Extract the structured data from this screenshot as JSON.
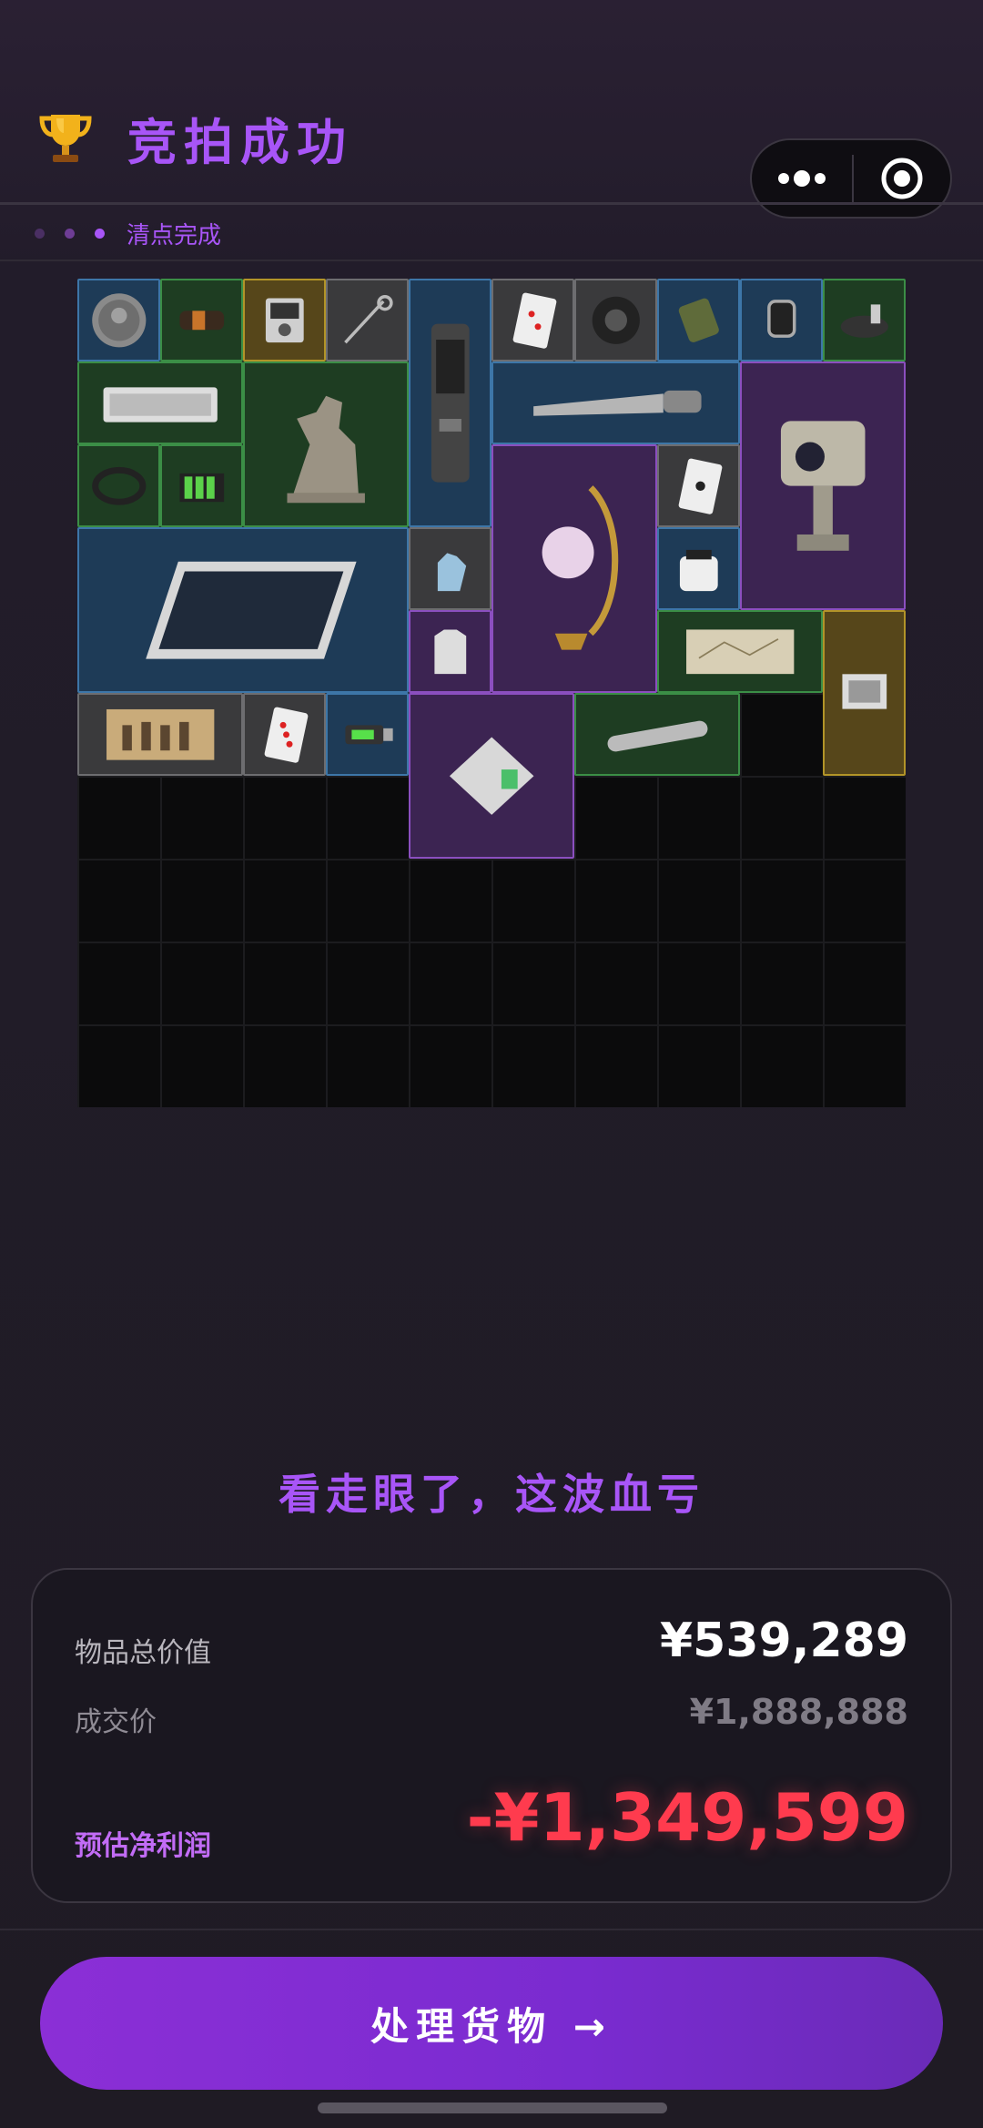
{
  "header": {
    "title": "竞拍成功",
    "trophy_icon": "trophy-icon",
    "status_text": "清点完成",
    "status_dots": [
      "#4a2f63",
      "#6e3d95",
      "#a855f7"
    ],
    "accent": "#a855f7"
  },
  "capsule": {
    "more_icon": "more-dots-icon",
    "close_icon": "target-icon"
  },
  "inventory": {
    "rarity_colors": {
      "blue": "#3d76a8",
      "green": "#3b8e46",
      "purple": "#8b4fbf",
      "gold": "#b29428",
      "gray": "#6d6d70"
    },
    "items": [
      {
        "name": "coin",
        "icon": "coin-icon",
        "rarity": "blue"
      },
      {
        "name": "cable-bundle",
        "icon": "cable-icon",
        "rarity": "green"
      },
      {
        "name": "multimeter",
        "icon": "multimeter-icon",
        "rarity": "gold"
      },
      {
        "name": "scissors",
        "icon": "scissors-icon",
        "rarity": "gray"
      },
      {
        "name": "rangefinder",
        "icon": "device-icon",
        "rarity": "blue"
      },
      {
        "name": "playing-card",
        "icon": "card-icon",
        "rarity": "gray"
      },
      {
        "name": "tape",
        "icon": "tape-icon",
        "rarity": "gray"
      },
      {
        "name": "ration-pack",
        "icon": "pack-icon",
        "rarity": "blue"
      },
      {
        "name": "smartwatch",
        "icon": "watch-icon",
        "rarity": "blue"
      },
      {
        "name": "tool-kit",
        "icon": "toolkit-icon",
        "rarity": "green"
      },
      {
        "name": "keyboard",
        "icon": "keyboard-icon",
        "rarity": "green"
      },
      {
        "name": "sphinx-statue",
        "icon": "statue-icon",
        "rarity": "green"
      },
      {
        "name": "saw",
        "icon": "saw-icon",
        "rarity": "blue"
      },
      {
        "name": "surveillance-camera",
        "icon": "camera-icon",
        "rarity": "purple"
      },
      {
        "name": "hose",
        "icon": "hose-icon",
        "rarity": "green"
      },
      {
        "name": "battery-pack",
        "icon": "battery-icon",
        "rarity": "green"
      },
      {
        "name": "moon-lamp",
        "icon": "lamp-icon",
        "rarity": "purple"
      },
      {
        "name": "club-card",
        "icon": "card-icon",
        "rarity": "gray"
      },
      {
        "name": "solar-panel",
        "icon": "solar-panel-icon",
        "rarity": "blue"
      },
      {
        "name": "gloves",
        "icon": "glove-icon",
        "rarity": "gray"
      },
      {
        "name": "jar",
        "icon": "jar-icon",
        "rarity": "blue"
      },
      {
        "name": "vest",
        "icon": "vest-icon",
        "rarity": "purple"
      },
      {
        "name": "old-map",
        "icon": "map-icon",
        "rarity": "green"
      },
      {
        "name": "photo-frame",
        "icon": "photo-icon",
        "rarity": "gold"
      },
      {
        "name": "old-photograph",
        "icon": "photo-icon",
        "rarity": "gray"
      },
      {
        "name": "heart-card",
        "icon": "card-icon",
        "rarity": "gray"
      },
      {
        "name": "usb-drive",
        "icon": "usb-icon",
        "rarity": "blue"
      },
      {
        "name": "ssd-drive",
        "icon": "ssd-icon",
        "rarity": "purple"
      },
      {
        "name": "glass-tube",
        "icon": "tube-icon",
        "rarity": "green"
      }
    ]
  },
  "verdict": "看走眼了，这波血亏",
  "summary": {
    "total_label": "物品总价值",
    "total_value": "¥539,289",
    "deal_label": "成交价",
    "deal_value": "¥1,888,888",
    "profit_label": "预估净利润",
    "profit_value": "-¥1,349,599",
    "profit_color": "#ff3b4e"
  },
  "cta": {
    "label": "处理货物 →"
  }
}
